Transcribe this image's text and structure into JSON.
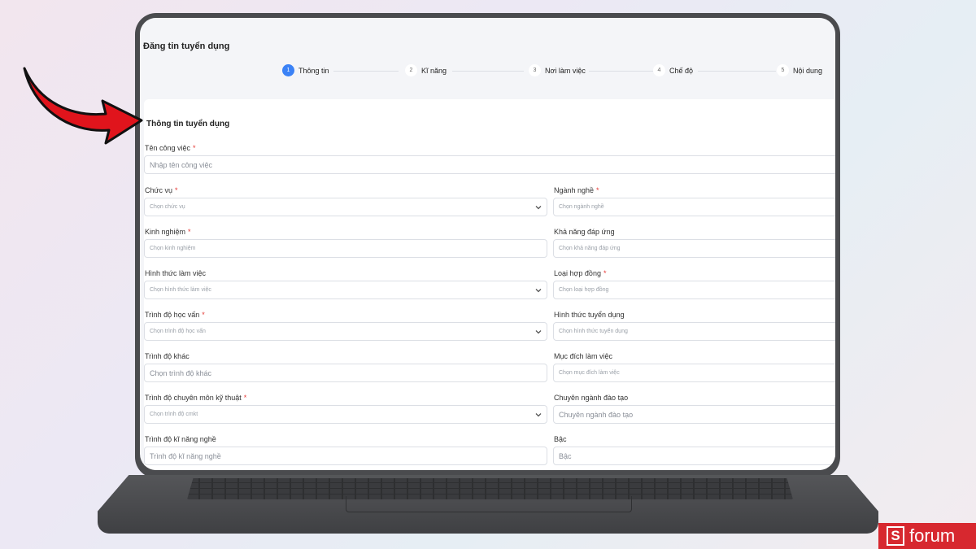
{
  "page": {
    "title": "Đăng tin tuyển dụng"
  },
  "steps": [
    {
      "num": "1",
      "label": "Thông tin",
      "active": true
    },
    {
      "num": "2",
      "label": "Kĩ năng",
      "active": false
    },
    {
      "num": "3",
      "label": "Nơi làm việc",
      "active": false
    },
    {
      "num": "4",
      "label": "Chế độ",
      "active": false
    },
    {
      "num": "5",
      "label": "Nội dung",
      "active": false
    }
  ],
  "form": {
    "section_title": "Thông tin tuyển dụng",
    "job_name": {
      "label": "Tên công việc",
      "placeholder": "Nhập tên công việc"
    },
    "left": [
      {
        "label": "Chức vụ",
        "required": true,
        "placeholder": "Chọn chức vụ"
      },
      {
        "label": "Kinh nghiệm",
        "required": true,
        "placeholder": "Chọn kinh nghiệm"
      },
      {
        "label": "Hình thức làm việc",
        "required": false,
        "placeholder": "Chọn hình thức làm việc"
      },
      {
        "label": "Trình độ học vấn",
        "required": true,
        "placeholder": "Chọn trình độ học vấn"
      },
      {
        "label": "Trình độ khác",
        "required": false,
        "placeholder": "Chọn trình độ khác"
      },
      {
        "label": "Trình độ chuyên môn kỹ thuật",
        "required": true,
        "placeholder": "Chọn trình độ cmkt"
      },
      {
        "label": "Trình độ kĩ năng nghề",
        "required": false,
        "placeholder": "Trình độ kĩ năng nghề"
      }
    ],
    "right": [
      {
        "label": "Ngành nghề",
        "required": true,
        "placeholder": "Chọn ngành nghề"
      },
      {
        "label": "Khả năng đáp ứng",
        "required": false,
        "placeholder": "Chọn khả năng đáp ứng"
      },
      {
        "label": "Loại hợp đồng",
        "required": true,
        "placeholder": "Chọn loại hợp đồng"
      },
      {
        "label": "Hình thức tuyển dụng",
        "required": false,
        "placeholder": "Chọn hình thức tuyển dụng"
      },
      {
        "label": "Mục đích làm việc",
        "required": false,
        "placeholder": "Chọn mục đích làm việc"
      },
      {
        "label": "Chuyên ngành đào tạo",
        "required": false,
        "placeholder": "Chuyên ngành đào tạo"
      },
      {
        "label": "Bậc",
        "required": false,
        "placeholder": "Bậc"
      }
    ]
  },
  "brand": {
    "logo_letter": "S",
    "logo_text": "forum"
  },
  "colors": {
    "accent": "#3b82f6",
    "required": "#e53935",
    "arrow": "#e0141c",
    "logo_bg": "#d7282f"
  },
  "icons": {
    "dropdown": "chevron-down-icon",
    "annotation": "red-arrow-icon"
  }
}
